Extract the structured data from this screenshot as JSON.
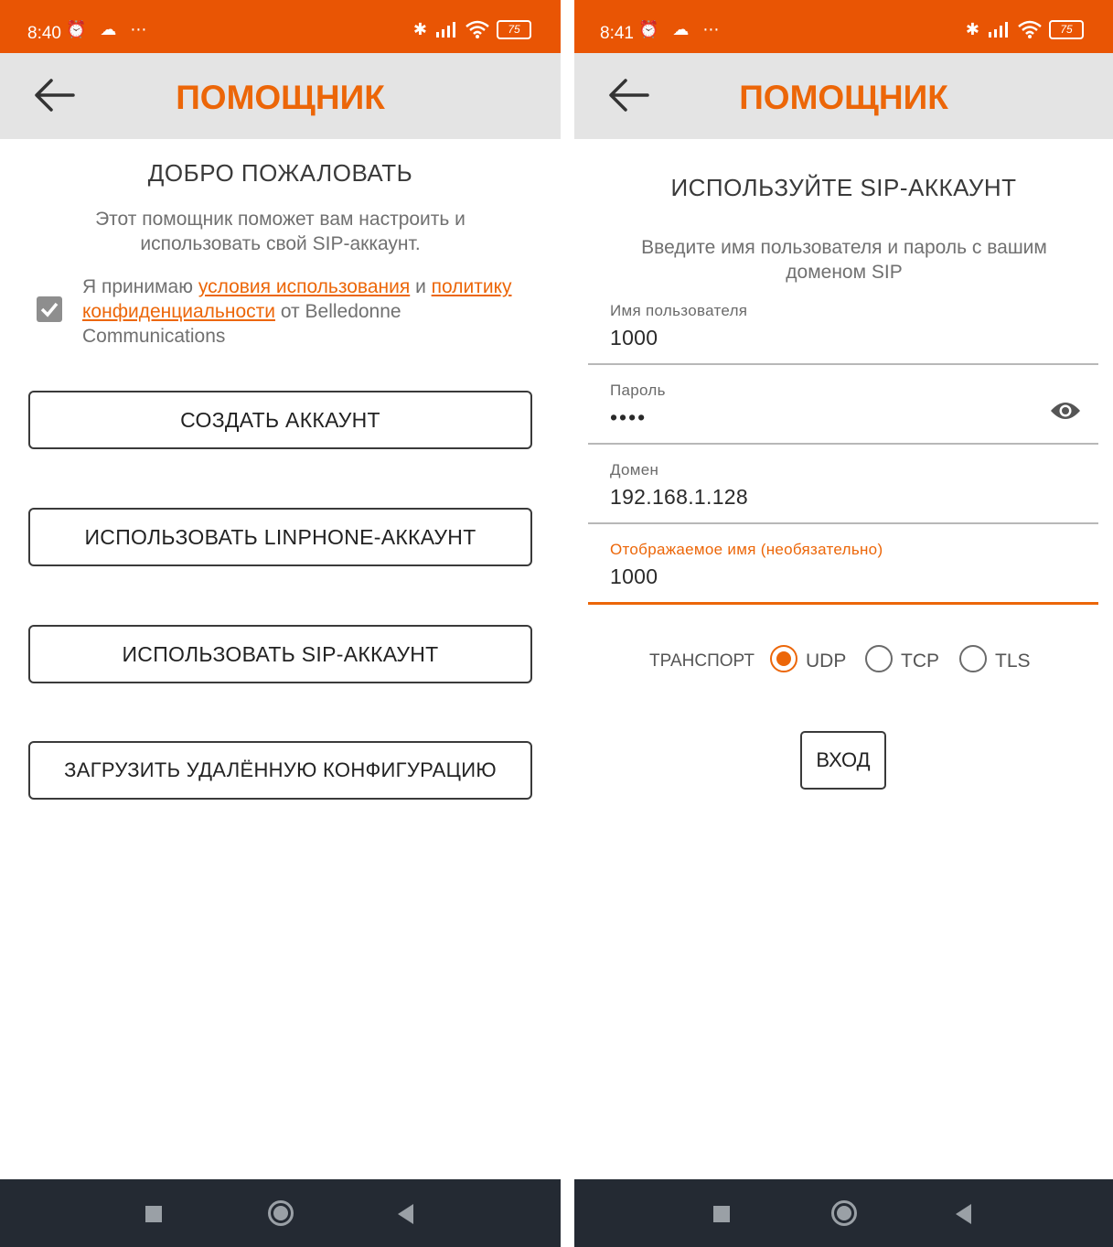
{
  "left": {
    "status": {
      "time": "8:40",
      "icons": "⏰ ☁ ⋯",
      "battery": "75"
    },
    "title": "ПОМОЩНИК",
    "heading": "ДОБРО ПОЖАЛОВАТЬ",
    "description": "Этот помощник поможет вам настроить и использовать свой SIP-аккаунт.",
    "consent": {
      "prefix": "Я принимаю ",
      "terms_link": "условия использования",
      "and": " и ",
      "privacy_link": "политику конфиденциальности",
      "suffix": " от Belledonne Communications",
      "checked": true
    },
    "buttons": {
      "create": "СОЗДАТЬ АККАУНТ",
      "linphone": "ИСПОЛЬЗОВАТЬ LINPHONE-АККАУНТ",
      "sip": "ИСПОЛЬЗОВАТЬ SIP-АККАУНТ",
      "remote": "ЗАГРУЗИТЬ УДАЛЁННУЮ КОНФИГУРАЦИЮ"
    }
  },
  "right": {
    "status": {
      "time": "8:41",
      "icons": "⏰ ☁ ⋯",
      "battery": "75"
    },
    "title": "ПОМОЩНИК",
    "heading": "ИСПОЛЬЗУЙТЕ SIP-АККАУНТ",
    "description": "Введите имя пользователя и пароль с вашим доменом SIP",
    "fields": {
      "username": {
        "label": "Имя пользователя",
        "value": "1000"
      },
      "password": {
        "label": "Пароль",
        "value": "••••"
      },
      "domain": {
        "label": "Домен",
        "value": "192.168.1.128"
      },
      "display_name": {
        "label": "Отображаемое имя (необязательно)",
        "value": "1000"
      }
    },
    "transport": {
      "label": "ТРАНСПОРТ",
      "options": [
        "UDP",
        "TCP",
        "TLS"
      ],
      "selected": "UDP"
    },
    "login": "ВХОД"
  },
  "colors": {
    "accent": "#ec6608",
    "statusbar": "#e95504",
    "navbar": "#242a33"
  },
  "icons": [
    "back-arrow-icon",
    "eye-icon",
    "alarm-icon",
    "cloud-icon",
    "bluetooth-icon",
    "signal-icon",
    "wifi-icon",
    "battery-icon",
    "nav-recents-icon",
    "nav-home-icon",
    "nav-back-icon"
  ]
}
